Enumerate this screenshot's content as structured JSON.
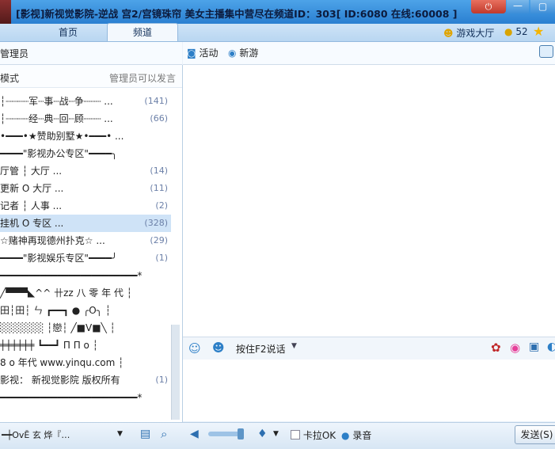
{
  "window": {
    "title": "[影视]新视觉影院-逆战 宫2/宫镜珠帘 美女主播集中营尽在频道ID：303[ ID:6080 在线:60008 ]",
    "close_label": "关闭",
    "min_label": "—",
    "max_label": "▢"
  },
  "tabs": {
    "home": "首页",
    "channel": "频道"
  },
  "header_right": {
    "game_hall": "游戏大厅",
    "coins": "52"
  },
  "left_toolbar": {
    "admin": "管理员"
  },
  "right_toolbar": {
    "activity": "活动",
    "newbie": "新游"
  },
  "mode": {
    "text": "模式",
    "note": "管理员可以发言"
  },
  "channel_rows": [
    {
      "text": "┆┈┈┈┈军┈事┈战┈争┈┈┈ ...",
      "count": "(141)"
    },
    {
      "text": "┆┈┈┈┈经┈典┈回┈顾┈┈┈ ...",
      "count": "(66)"
    },
    {
      "text": "•━━━•★赞助别墅★•━━━• ...",
      "count": ""
    },
    {
      "text": "━━━━\"影视办公专区\"━━━━╮",
      "count": ""
    },
    {
      "text": "   厅管     ┆      大厅   ...",
      "count": "(14)"
    },
    {
      "text": "   更新     O      大厅   ...",
      "count": "(11)"
    },
    {
      "text": "   记者     ┆      人事   ...",
      "count": "(2)"
    },
    {
      "text": "   挂机     O      专区   ...",
      "count": "(328)"
    },
    {
      "text": "   ☆赌神再现德州扑克☆   ...",
      "count": "(29)"
    },
    {
      "text": "━━━━\"影视娱乐专区\"━━━━╯",
      "count": "(1)"
    },
    {
      "text": "━━━━━━━━━━━━━━━━━━━━━━━━*",
      "count": ""
    },
    {
      "text": "  ╱▀▀▀◣^^ 卄zz  八 零 年 代  ┆",
      "count": ""
    },
    {
      "text": "  田┆田┆ ㄣ ┏━━┓   ●  ╭O╮ ┆",
      "count": ""
    },
    {
      "text": "  ░░░░░░ ┆戀┆ ╱■V■╲ ┆",
      "count": ""
    },
    {
      "text": " ╪╪╪╪╪╪  ┗━━┛   Π   Π o ┆",
      "count": ""
    },
    {
      "text": "  8 o 年代        www.yinqu.com  ┆",
      "count": ""
    },
    {
      "text": "  影视： 新视觉影院    版权所有",
      "count": "(1)"
    },
    {
      "text": "━━━━━━━━━━━━━━━━━━━━━━━━*",
      "count": ""
    }
  ],
  "input": {
    "f2_label": "按住F2说话"
  },
  "bottom": {
    "left_text": "━┿OvĒ 玄  烨『…",
    "karaoke": "卡拉OK",
    "record": "录音",
    "send": "发送(S)"
  },
  "colors": {
    "title_bar": "#2a7fd1",
    "selected_row": "#cfe3f7",
    "count_text": "#6c80a8"
  }
}
